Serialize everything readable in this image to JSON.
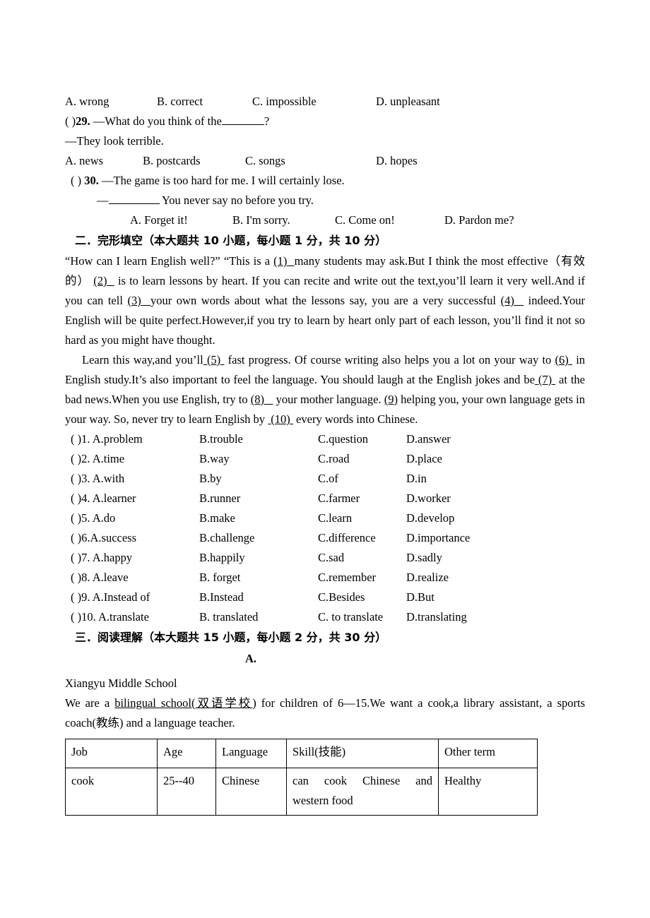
{
  "question_28_options": {
    "a": "A. wrong",
    "b": "B. correct",
    "c": "C. impossible",
    "d": "D. unpleasant"
  },
  "question_29": {
    "marker": "(   )",
    "number": "29.",
    "stem_before": "—What do you think of the",
    "stem_after": "?",
    "reply": "—They look terrible.",
    "options": {
      "a": "A. news",
      "b": "B. postcards",
      "c": "C. songs",
      "d": "D. hopes"
    }
  },
  "question_30": {
    "marker": "(   )",
    "number": "30.",
    "stem": "—The game is too hard for me. I will certainly lose.",
    "reply_dash": "—",
    "reply_after": "You never say no before you try.",
    "options": {
      "a": "A. Forget it!",
      "b": "B. I'm sorry.",
      "c": "C. Come on!",
      "d": "D. Pardon me?"
    }
  },
  "section_two": {
    "heading": "二．完形填空（本大题共 10 小题，每小题 1 分，共 10 分）",
    "paragraph_1_parts": {
      "t1": "“How can I learn English well?” “This is a ",
      "b1": "(1)",
      "t2": "many students may ask.But I think the most effective（有效的）",
      "b2": "(2)",
      "t3": "is to learn lessons by heart. If you can recite and write out the text,you’ll learn it very well.And if you can tell ",
      "b3": "(3)",
      "t4": "your own words about what the lessons say, you are a very successful ",
      "b4": "(4)",
      "t5": "indeed.Your English will be quite perfect.However,if you try to learn by heart only part of each lesson, you’ll find it not so hard as you might have thought."
    },
    "paragraph_2_parts": {
      "t1": "Learn this way,and you’ll",
      "b5": "(5)",
      "t2": "fast progress. Of course writing also helps you a lot on your way to ",
      "b6": "(6)",
      "t3": "in English study.It’s also important to feel the language. You should laugh at the English jokes and be",
      "b7": "(7)",
      "t4": "at the bad news.When you use English, try to ",
      "b8": "(8)",
      "t5": "your mother language. ",
      "b9": "(9)",
      "t6": "helping you, your own language gets in your way. So, never try to learn English by ",
      "b10": "(10)",
      "t7": "every words into Chinese."
    },
    "options": [
      {
        "marker": "(   )",
        "num": "1.",
        "a": "A.problem",
        "b": "B.trouble",
        "c": "C.question",
        "d": "D.answer"
      },
      {
        "marker": "(   )",
        "num": "2.",
        "a": "A.time",
        "b": "B.way",
        "c": "C.road",
        "d": "D.place"
      },
      {
        "marker": "(   )",
        "num": "3.",
        "a": "A.with",
        "b": "B.by",
        "c": "C.of",
        "d": "D.in"
      },
      {
        "marker": "(   )",
        "num": "4.",
        "a": "A.learner",
        "b": "B.runner",
        "c": "C.farmer",
        "d": "D.worker"
      },
      {
        "marker": "(   )",
        "num": "5.",
        "a": "A.do",
        "b": "B.make",
        "c": "C.learn",
        "d": "D.develop"
      },
      {
        "marker": "(   )",
        "num": "6.",
        "a": "A.success",
        "b": "B.challenge",
        "c": "C.difference",
        "d": "D.importance"
      },
      {
        "marker": "(   )",
        "num": "7.",
        "a": "A.happy",
        "b": "B.happily",
        "c": "C.sad",
        "d": "D.sadly"
      },
      {
        "marker": "(   )",
        "num": "8.",
        "a": "A.leave",
        "b": "B. forget",
        "c": "C.remember",
        "d": "D.realize"
      },
      {
        "marker": "(   )",
        "num": "9.",
        "a": "A.Instead of",
        "b": "B.Instead",
        "c": "C.Besides",
        "d": "D.But"
      },
      {
        "marker": "(   )",
        "num": "10.",
        "a": "A.translate",
        "b": "B. translated",
        "c": "C. to translate",
        "d": "D.translating"
      }
    ]
  },
  "section_three": {
    "heading": "三．阅读理解（本大题共 15 小题，每小题 2 分，共 30 分）",
    "part_marker": "A.",
    "school_name": "Xiangyu Middle School",
    "intro_parts": {
      "t1": "We are a ",
      "u1": "bilingual school(双语学校",
      "t2": ") for children of 6—15.We want a cook,a library assistant, a sports coach(教练) and a language teacher."
    },
    "table": {
      "headers": [
        "Job",
        "Age",
        "Language",
        "Skill(技能)",
        "Other term"
      ],
      "rows": [
        [
          "cook",
          "25--40",
          "Chinese",
          "can cook Chinese and western food",
          "Healthy"
        ]
      ]
    }
  }
}
